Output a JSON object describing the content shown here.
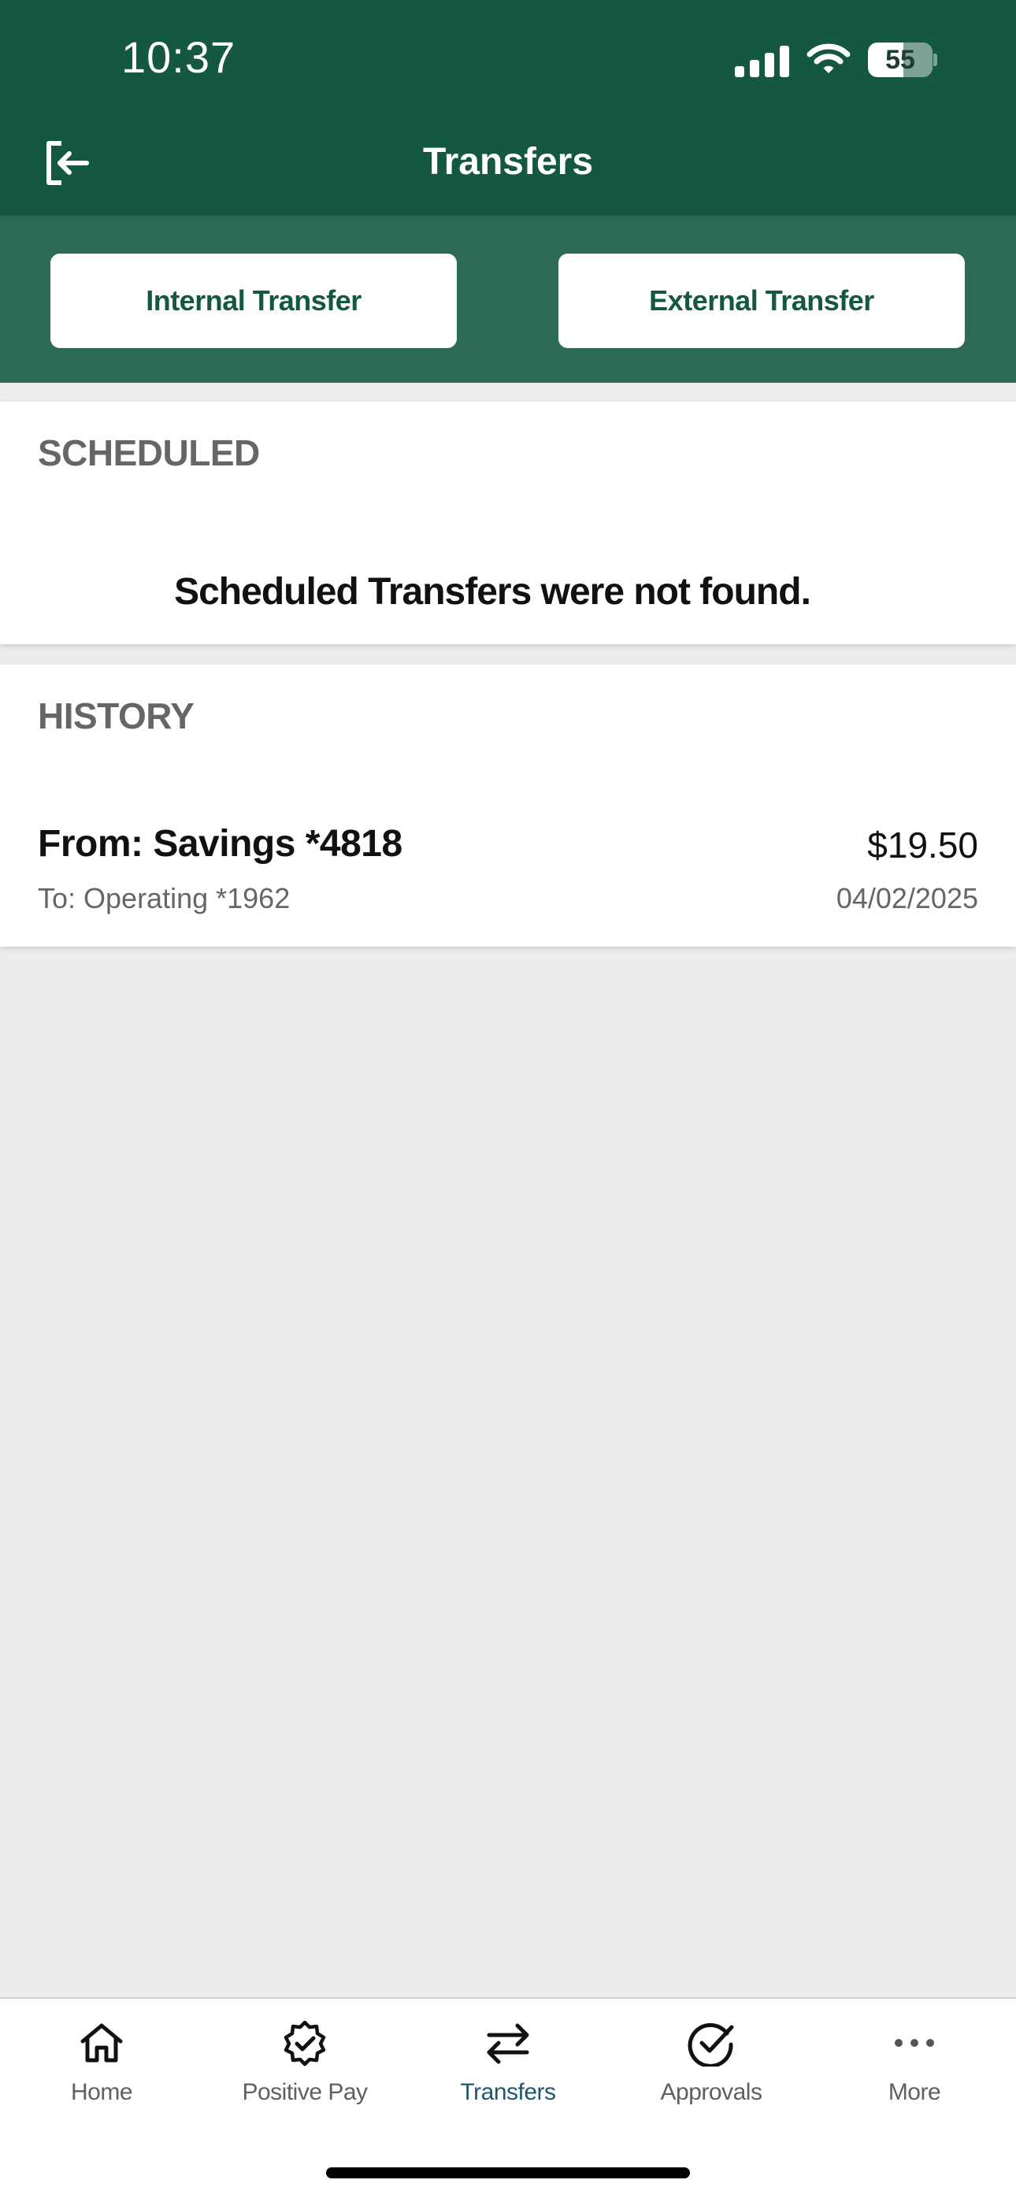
{
  "status_bar": {
    "time": "10:37",
    "battery": "55",
    "battery_level": 0.55
  },
  "header": {
    "title": "Transfers",
    "logout_icon": "logout-icon"
  },
  "transfer_types": {
    "internal_label": "Internal Transfer",
    "external_label": "External Transfer"
  },
  "scheduled": {
    "heading": "SCHEDULED",
    "empty_message": "Scheduled Transfers were not found."
  },
  "history": {
    "heading": "HISTORY",
    "items": [
      {
        "from": "From: Savings *4818",
        "to": "To: Operating *1962",
        "amount": "$19.50",
        "date": "04/02/2025"
      }
    ]
  },
  "tabs": [
    {
      "label": "Home",
      "icon": "home-icon"
    },
    {
      "label": "Positive Pay",
      "icon": "badge-check-icon"
    },
    {
      "label": "Transfers",
      "icon": "transfer-arrows-icon",
      "active": true
    },
    {
      "label": "Approvals",
      "icon": "check-circle-icon"
    },
    {
      "label": "More",
      "icon": "more-dots-icon"
    }
  ],
  "colors": {
    "header": "#145840",
    "button_band": "#2c6a55",
    "active_tab": "#1f5672",
    "background": "#ededed"
  }
}
